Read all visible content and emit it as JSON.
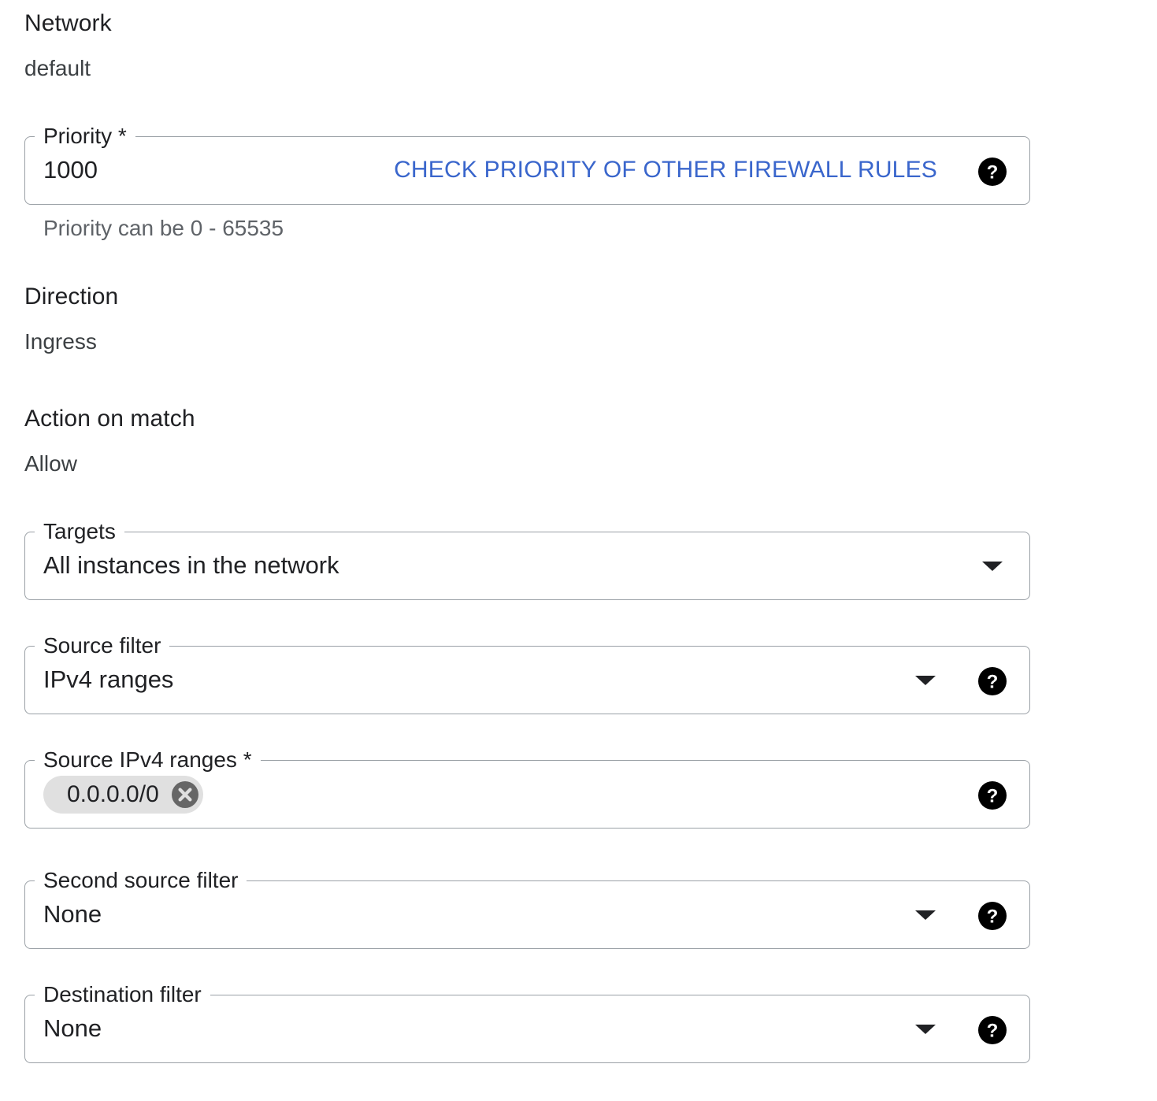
{
  "network": {
    "label": "Network",
    "value": "default"
  },
  "priority": {
    "label": "Priority *",
    "value": "1000",
    "link_label": "CHECK PRIORITY OF OTHER FIREWALL RULES",
    "hint": "Priority can be 0 - 65535",
    "help_icon": "help-circle-icon",
    "link_color": "#3a66cc"
  },
  "direction": {
    "label": "Direction",
    "value": "Ingress"
  },
  "action": {
    "label": "Action on match",
    "value": "Allow"
  },
  "targets": {
    "label": "Targets",
    "value": "All instances in the network",
    "dropdown_icon": "dropdown-arrow-icon"
  },
  "source_filter": {
    "label": "Source filter",
    "value": "IPv4 ranges",
    "dropdown_icon": "dropdown-arrow-icon",
    "help_icon": "help-circle-icon"
  },
  "source_ranges": {
    "label": "Source IPv4 ranges *",
    "chips": [
      "0.0.0.0/0"
    ],
    "chip_remove_icon": "cancel-circle-icon",
    "help_icon": "help-circle-icon"
  },
  "second_source_filter": {
    "label": "Second source filter",
    "value": "None",
    "dropdown_icon": "dropdown-arrow-icon",
    "help_icon": "help-circle-icon"
  },
  "destination_filter": {
    "label": "Destination filter",
    "value": "None",
    "dropdown_icon": "dropdown-arrow-icon",
    "help_icon": "help-circle-icon"
  }
}
